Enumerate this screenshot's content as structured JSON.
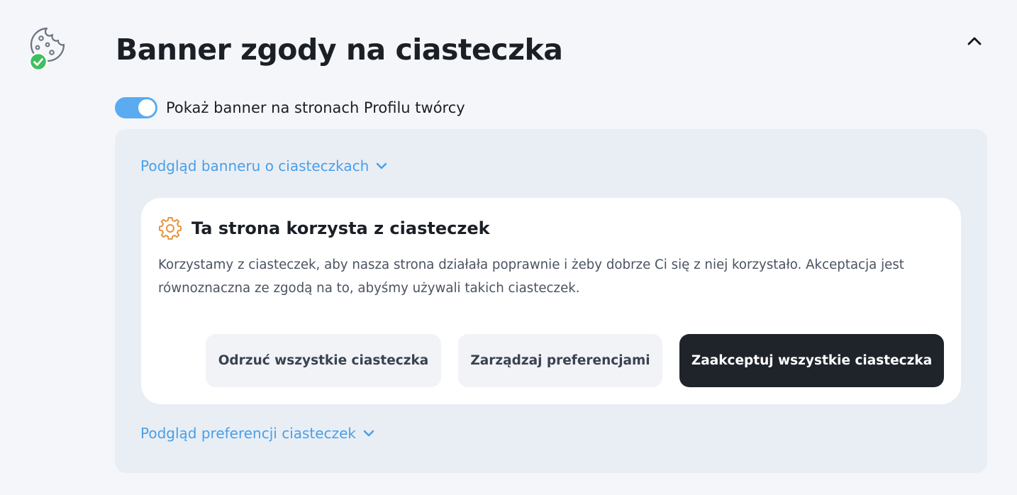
{
  "header": {
    "title": "Banner zgody na ciasteczka",
    "icon": "cookie-check-icon",
    "collapse_icon": "chevron-up-icon"
  },
  "toggle": {
    "label": "Pokaż banner na stronach Profilu twórcy",
    "state": "on"
  },
  "preview": {
    "banner_link": "Podgląd banneru o ciasteczkach",
    "preferences_link": "Podgląd preferencji ciasteczek",
    "banner": {
      "icon": "gear-icon",
      "title": "Ta strona korzysta z ciasteczek",
      "body": "Korzystamy z ciasteczek, aby nasza strona działała poprawnie i żeby dobrze Ci się z niej korzystało. Akceptacja jest równoznaczna ze zgodą na to, abyśmy używali takich ciasteczek.",
      "buttons": {
        "reject": "Odrzuć wszystkie ciasteczka",
        "manage": "Zarządzaj preferencjami",
        "accept": "Zaakceptuj wszystkie ciasteczka"
      }
    }
  },
  "colors": {
    "accent": "#5aabf0",
    "link": "#4a9fe6",
    "success": "#3fbf60",
    "warning_icon": "#e8943a",
    "primary_button": "#1f242b",
    "panel_bg": "#e9eef5",
    "page_bg": "#f4f6f9"
  }
}
